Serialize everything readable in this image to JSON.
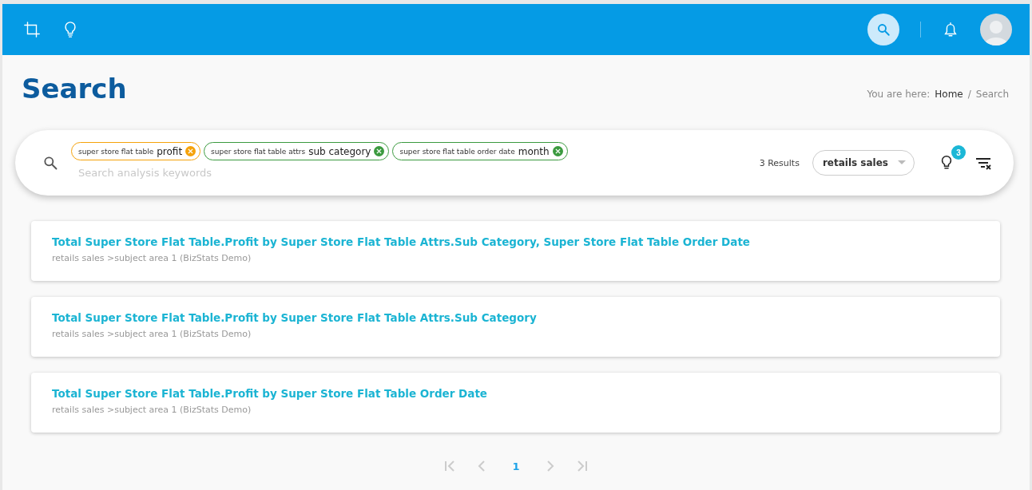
{
  "page_title": "Search",
  "breadcrumb": {
    "label": "You are here:",
    "separator": "/",
    "items": [
      "Home",
      "Search"
    ]
  },
  "search": {
    "chips": [
      {
        "prefix": "super store flat table",
        "value": "profit",
        "color": "#f5a20a"
      },
      {
        "prefix": "super store flat table attrs",
        "value": "sub category",
        "color": "#3b9a3f"
      },
      {
        "prefix": "super store flat table order date",
        "value": "month",
        "color": "#3b9a3f"
      }
    ],
    "placeholder": "Search analysis keywords",
    "results_count": "3 Results",
    "subject_area": "retails sales",
    "suggestions_badge": "3"
  },
  "results": [
    {
      "title": "Total Super Store Flat Table.Profit by Super Store Flat Table Attrs.Sub Category, Super Store Flat Table Order Date",
      "path": "retails sales >subject area 1 (BizStats Demo)"
    },
    {
      "title": "Total Super Store Flat Table.Profit by Super Store Flat Table Attrs.Sub Category",
      "path": "retails sales >subject area 1 (BizStats Demo)"
    },
    {
      "title": "Total Super Store Flat Table.Profit by Super Store Flat Table Order Date",
      "path": "retails sales >subject area 1 (BizStats Demo)"
    }
  ],
  "pagination": {
    "pages": [
      {
        "label": "1",
        "selected": true
      }
    ]
  }
}
